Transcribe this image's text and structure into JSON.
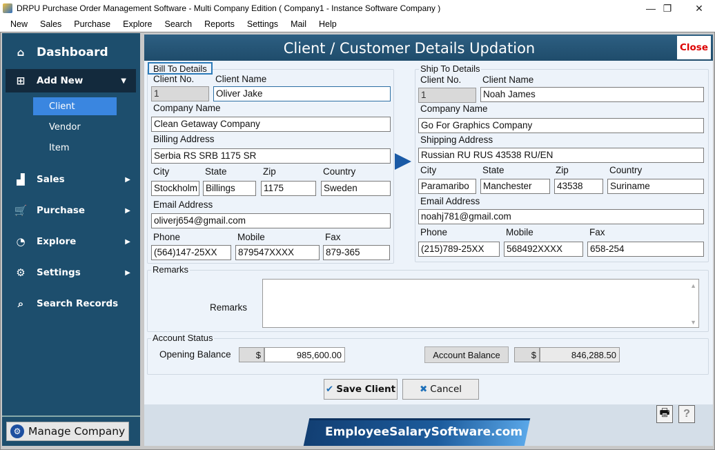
{
  "window": {
    "title": "DRPU Purchase Order Management Software - Multi Company Edition ( Company1 - Instance Software Company )",
    "controls": {
      "minimize": "—",
      "restore": "❐",
      "close": "✕"
    }
  },
  "menubar": [
    "New",
    "Sales",
    "Purchase",
    "Explore",
    "Search",
    "Reports",
    "Settings",
    "Mail",
    "Help"
  ],
  "sidebar": {
    "dashboard": {
      "label": "Dashboard",
      "icon": "home-icon",
      "glyph": "⌂"
    },
    "add_new": {
      "label": "Add New",
      "icon": "add-file-icon",
      "glyph": "⊞",
      "arrow": "▼"
    },
    "sub_items": [
      {
        "label": "Client",
        "active": true
      },
      {
        "label": "Vendor",
        "active": false
      },
      {
        "label": "Item",
        "active": false
      }
    ],
    "items": [
      {
        "label": "Sales",
        "icon": "chart-icon",
        "glyph": "▟",
        "arrow": "▶"
      },
      {
        "label": "Purchase",
        "icon": "cart-icon",
        "glyph": "🛒",
        "arrow": "▶"
      },
      {
        "label": "Explore",
        "icon": "pie-chart-icon",
        "glyph": "◔",
        "arrow": "▶"
      },
      {
        "label": "Settings",
        "icon": "gear-icon",
        "glyph": "⚙",
        "arrow": "▶"
      },
      {
        "label": "Search Records",
        "icon": "search-icon",
        "glyph": "⌕",
        "arrow": ""
      }
    ],
    "manage_company": {
      "label": "Manage Company",
      "glyph": "⚙"
    }
  },
  "main": {
    "title": "Client / Customer Details Updation",
    "close_label": "Close",
    "bill": {
      "legend": "Bill To Details",
      "labels": {
        "client_no": "Client No.",
        "client_name": "Client Name",
        "company": "Company Name",
        "address": "Billing Address",
        "city": "City",
        "state": "State",
        "zip": "Zip",
        "country": "Country",
        "email": "Email Address",
        "phone": "Phone",
        "mobile": "Mobile",
        "fax": "Fax"
      },
      "values": {
        "client_no": "1",
        "client_name": "Oliver Jake",
        "company": "Clean Getaway Company",
        "address": "Serbia RS SRB 1175 SR",
        "city": "Stockholm",
        "state": "Billings",
        "zip": "1175",
        "country": "Sweden",
        "email": "oliverj654@gmail.com",
        "phone": "(564)147-25XX",
        "mobile": "879547XXXX",
        "fax": "879-365"
      }
    },
    "ship": {
      "legend": "Ship To Details",
      "labels": {
        "client_no": "Client No.",
        "client_name": "Client Name",
        "company": "Company Name",
        "address": "Shipping Address",
        "city": "City",
        "state": "State",
        "zip": "Zip",
        "country": "Country",
        "email": "Email Address",
        "phone": "Phone",
        "mobile": "Mobile",
        "fax": "Fax"
      },
      "values": {
        "client_no": "1",
        "client_name": "Noah James",
        "company": "Go For Graphics Company",
        "address": "Russian RU RUS 43538 RU/EN",
        "city": "Paramaribo",
        "state": "Manchester",
        "zip": "43538",
        "country": "Suriname",
        "email": "noahj781@gmail.com",
        "phone": "(215)789-25XX",
        "mobile": "568492XXXX",
        "fax": "658-254"
      }
    },
    "remarks": {
      "legend": "Remarks",
      "label": "Remarks",
      "value": ""
    },
    "account": {
      "legend": "Account Status",
      "opening_label": "Opening Balance",
      "currency": "$",
      "opening_value": "985,600.00",
      "balance_button": "Account Balance",
      "balance_value": "846,288.50"
    },
    "buttons": {
      "save": "Save Client",
      "cancel": "Cancel"
    },
    "footer": {
      "brand": "EmployeeSalarySoftware.com",
      "print_icon": "🖶",
      "help_icon": "?"
    }
  },
  "colors": {
    "sidebar": "#1d4e6d",
    "active": "#3a86e0",
    "header": "#2d5f82",
    "close": "#dd0000"
  }
}
